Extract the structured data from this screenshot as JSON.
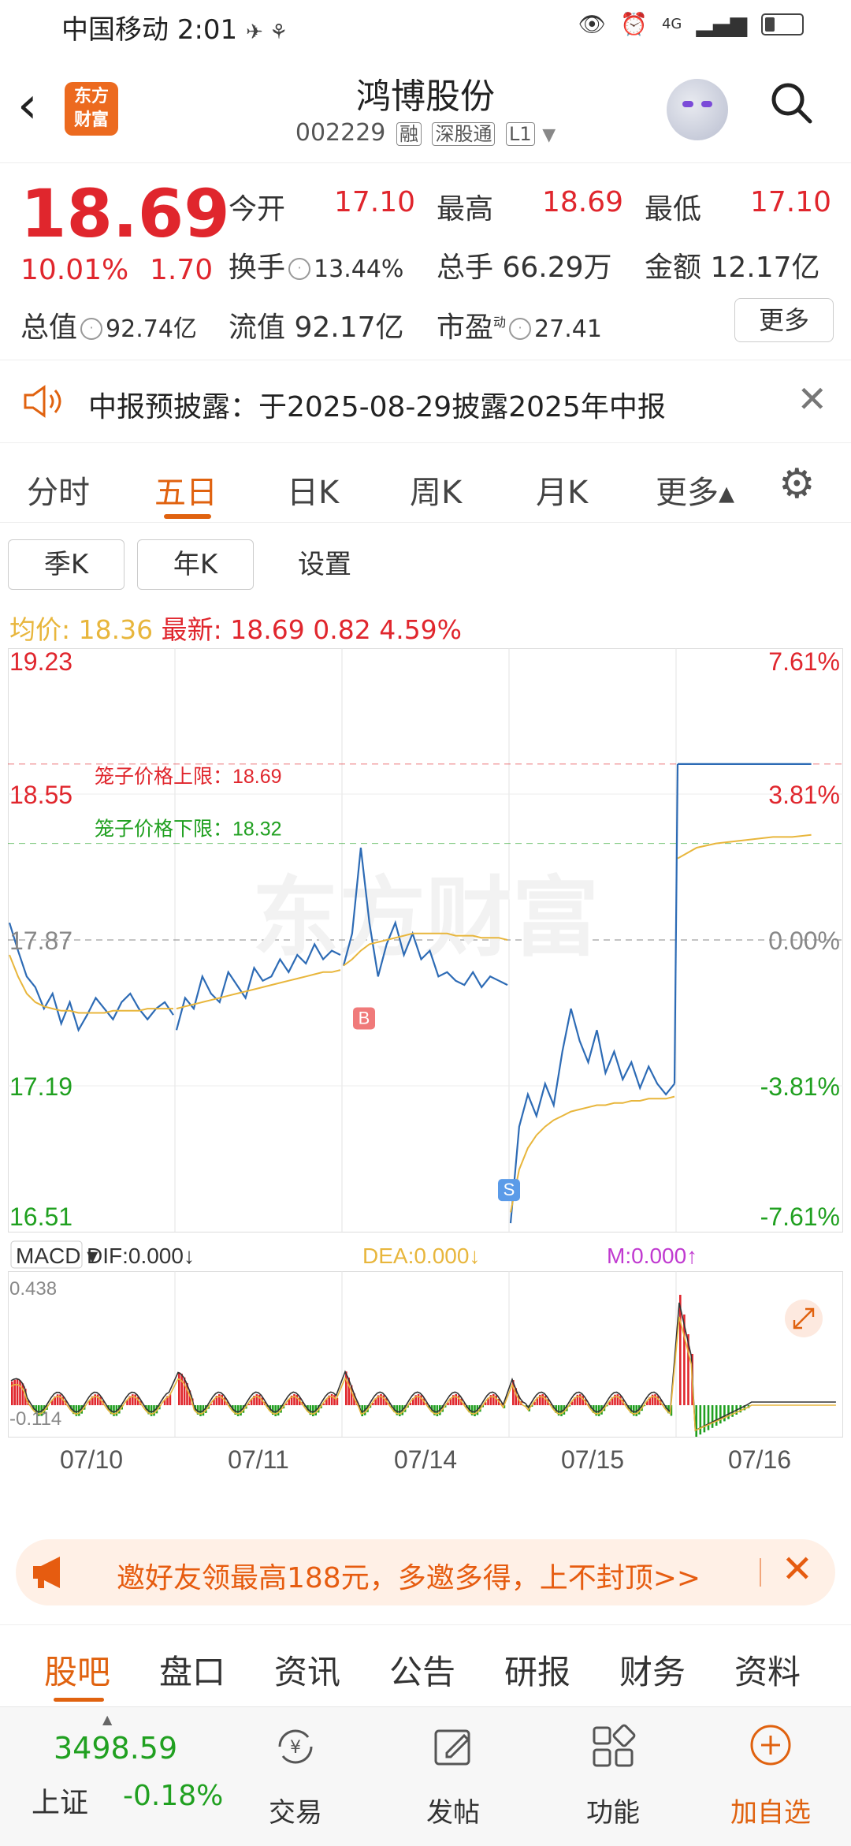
{
  "status_bar": {
    "carrier": "中国移动",
    "time": "2:01",
    "network": "4G"
  },
  "header": {
    "logo_line1": "东方",
    "logo_line2": "财富",
    "stock_name": "鸿博股份",
    "stock_code": "002229",
    "tags": [
      "融",
      "深股通",
      "L1"
    ]
  },
  "quote": {
    "price": "18.69",
    "change_pct": "10.01%",
    "change_amt": "1.70",
    "open_label": "今开",
    "open": "17.10",
    "high_label": "最高",
    "high": "18.69",
    "low_label": "最低",
    "low": "17.10",
    "turnover_label": "换手",
    "turnover": "13.44%",
    "volume_label": "总手",
    "volume": "66.29万",
    "amount_label": "金额",
    "amount": "12.17亿",
    "mcap_label": "总值",
    "mcap": "92.74亿",
    "float_label": "流值",
    "float": "92.17亿",
    "pe_label": "市盈",
    "pe_sup": "动",
    "pe": "27.41",
    "more_label": "更多"
  },
  "notice": {
    "text": "中报预披露：于2025-08-29披露2025年中报"
  },
  "tabs": [
    "分时",
    "五日",
    "日K",
    "周K",
    "月K",
    "更多▴"
  ],
  "active_tab": "五日",
  "subtabs": [
    "季K",
    "年K",
    "设置"
  ],
  "avg_line": {
    "avg_label": "均价:",
    "avg": "18.36",
    "latest_label": "最新:",
    "latest": "18.69",
    "chg": "0.82",
    "pct": "4.59%"
  },
  "chart_data": {
    "type": "line",
    "title": "",
    "price_axis_left": [
      "19.23",
      "18.55",
      "17.87",
      "17.19",
      "16.51"
    ],
    "price_axis_right": [
      "7.61%",
      "3.81%",
      "0.00%",
      "-3.81%",
      "-7.61%"
    ],
    "ylim": [
      16.51,
      19.23
    ],
    "x_labels": [
      "07/10",
      "07/11",
      "07/14",
      "07/15",
      "07/16"
    ],
    "cage_upper_label": "笼子价格上限：18.69",
    "cage_lower_label": "笼子价格下限：18.32",
    "cage_upper": 18.69,
    "cage_lower": 18.32,
    "watermark": "东方财富",
    "markers": [
      {
        "label": "B",
        "day": 2,
        "price": 17.6
      },
      {
        "label": "S",
        "day": 3,
        "price": 16.8
      }
    ],
    "series": [
      {
        "name": "price",
        "color": "#2d6bb5",
        "days": [
          [
            17.95,
            17.82,
            17.7,
            17.65,
            17.55,
            17.62,
            17.48,
            17.58,
            17.45,
            17.52,
            17.6,
            17.55,
            17.5,
            17.58,
            17.62,
            17.55,
            17.5,
            17.55,
            17.58,
            17.52
          ],
          [
            17.45,
            17.6,
            17.55,
            17.7,
            17.62,
            17.58,
            17.72,
            17.66,
            17.6,
            17.74,
            17.68,
            17.7,
            17.78,
            17.72,
            17.8,
            17.76,
            17.85,
            17.78,
            17.82,
            17.8
          ],
          [
            17.75,
            17.9,
            18.3,
            17.95,
            17.7,
            17.85,
            17.95,
            17.8,
            17.9,
            17.78,
            17.82,
            17.7,
            17.72,
            17.68,
            17.66,
            17.72,
            17.65,
            17.7,
            17.68,
            17.66
          ],
          [
            16.55,
            17.0,
            17.15,
            17.05,
            17.2,
            17.1,
            17.35,
            17.55,
            17.4,
            17.3,
            17.45,
            17.25,
            17.35,
            17.22,
            17.3,
            17.18,
            17.28,
            17.2,
            17.15,
            17.2
          ],
          [
            18.69,
            18.69,
            18.69,
            18.69,
            18.69,
            18.69,
            18.69,
            18.69
          ]
        ]
      },
      {
        "name": "avg",
        "color": "#e8b63c",
        "days": [
          [
            17.8,
            17.7,
            17.62,
            17.58,
            17.56,
            17.55,
            17.54,
            17.54,
            17.53,
            17.53,
            17.53,
            17.53,
            17.54,
            17.54,
            17.54,
            17.54,
            17.55,
            17.55,
            17.55,
            17.55
          ],
          [
            17.55,
            17.56,
            17.57,
            17.58,
            17.59,
            17.6,
            17.61,
            17.62,
            17.63,
            17.64,
            17.65,
            17.66,
            17.67,
            17.68,
            17.69,
            17.7,
            17.71,
            17.72,
            17.72,
            17.73
          ],
          [
            17.75,
            17.78,
            17.82,
            17.85,
            17.86,
            17.87,
            17.88,
            17.89,
            17.9,
            17.9,
            17.9,
            17.9,
            17.9,
            17.89,
            17.89,
            17.89,
            17.88,
            17.88,
            17.88,
            17.87
          ],
          [
            16.6,
            16.8,
            16.9,
            16.96,
            17.0,
            17.03,
            17.05,
            17.07,
            17.08,
            17.09,
            17.1,
            17.1,
            17.11,
            17.11,
            17.12,
            17.12,
            17.13,
            17.13,
            17.13,
            17.14
          ],
          [
            18.25,
            18.3,
            18.32,
            18.33,
            18.34,
            18.35,
            18.35,
            18.36
          ]
        ]
      }
    ],
    "macd": {
      "indicator": "MACD",
      "dif_label": "DIF:0.000↓",
      "dea_label": "DEA:0.000↓",
      "m_label": "M:0.000↑",
      "top": "0.438",
      "bottom": "-0.114"
    }
  },
  "promo": {
    "text": "邀好友领最高188元，多邀多得，上不封顶>>"
  },
  "bottom_tabs": [
    "股吧",
    "盘口",
    "资讯",
    "公告",
    "研报",
    "财务",
    "资料"
  ],
  "active_bottom": "股吧",
  "footer": {
    "index_value": "3498.59",
    "index_name": "上证",
    "index_change": "-0.18%",
    "items": [
      "交易",
      "发帖",
      "功能",
      "加自选"
    ]
  },
  "colors": {
    "red": "#e0262d",
    "green": "#20a020",
    "orange": "#e0620f",
    "blue": "#2d6bb5",
    "gold": "#e8b63c"
  }
}
